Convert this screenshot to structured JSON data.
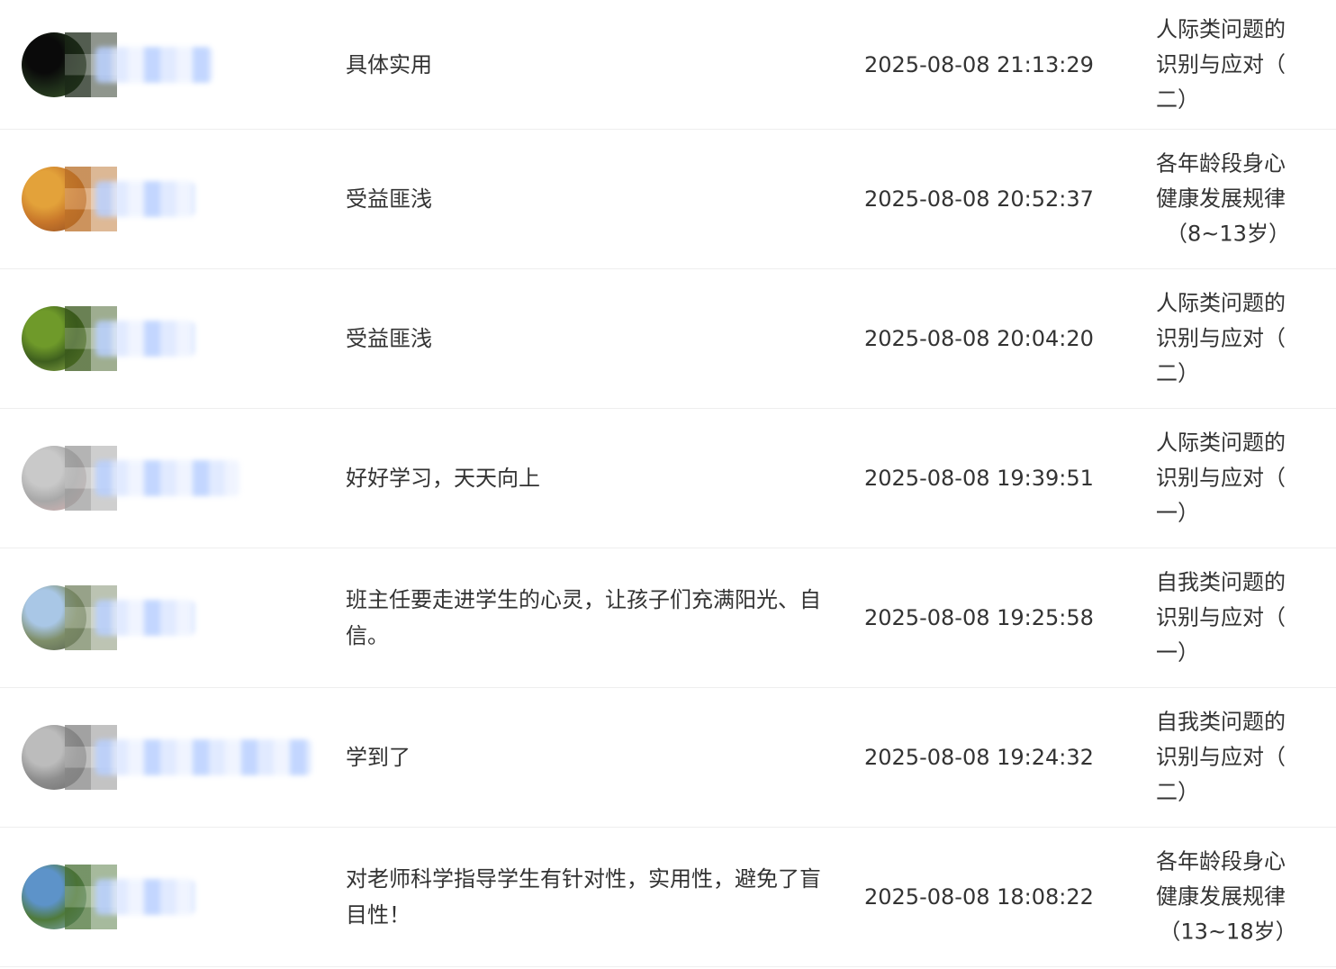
{
  "rows": [
    {
      "comment": "具体实用",
      "time": "2025-08-08 21:13:29",
      "course": [
        "人际类问题的",
        "识别与应对（",
        "二）"
      ],
      "course_center_last": false,
      "avatar_colors": [
        "#0a0a0a",
        "#1c2a18",
        "#3d5a2a"
      ],
      "name_width": 130
    },
    {
      "comment": "受益匪浅",
      "time": "2025-08-08 20:52:37",
      "course": [
        "各年龄段身心",
        "健康发展规律",
        "（8~13岁）"
      ],
      "course_center_last": true,
      "avatar_colors": [
        "#e3a23a",
        "#c8772a",
        "#8a4a22"
      ],
      "name_width": 110
    },
    {
      "comment": "受益匪浅",
      "time": "2025-08-08 20:04:20",
      "course": [
        "人际类问题的",
        "识别与应对（",
        "二）"
      ],
      "course_center_last": false,
      "avatar_colors": [
        "#6f9a2a",
        "#3e5f1e",
        "#9dbb52"
      ],
      "name_width": 110
    },
    {
      "comment": "好好学习，天天向上",
      "time": "2025-08-08 19:39:51",
      "course": [
        "人际类问题的",
        "识别与应对（",
        "一）"
      ],
      "course_center_last": false,
      "avatar_colors": [
        "#c9c9c9",
        "#a8a8a8",
        "#e3b5b5"
      ],
      "name_width": 160
    },
    {
      "comment": "班主任要走进学生的心灵，让孩子们充满阳光、自信。",
      "time": "2025-08-08 19:25:58",
      "course": [
        "自我类问题的",
        "识别与应对（",
        "一）"
      ],
      "course_center_last": false,
      "avatar_colors": [
        "#a9c7e6",
        "#7f8f6a",
        "#505a4c"
      ],
      "name_width": 110
    },
    {
      "comment": "学到了",
      "time": "2025-08-08 19:24:32",
      "course": [
        "自我类问题的",
        "识别与应对（",
        "二）"
      ],
      "course_center_last": false,
      "avatar_colors": [
        "#bcbcbc",
        "#8e8e8e",
        "#6a6a6a"
      ],
      "name_width": 240
    },
    {
      "comment": "对老师科学指导学生有针对性，实用性，避免了盲目性！",
      "time": "2025-08-08 18:08:22",
      "course": [
        "各年龄段身心",
        "健康发展规律",
        "（13~18岁）"
      ],
      "course_center_last": true,
      "avatar_colors": [
        "#5d93c9",
        "#4f7a3a",
        "#8fb4d9"
      ],
      "name_width": 110
    }
  ]
}
